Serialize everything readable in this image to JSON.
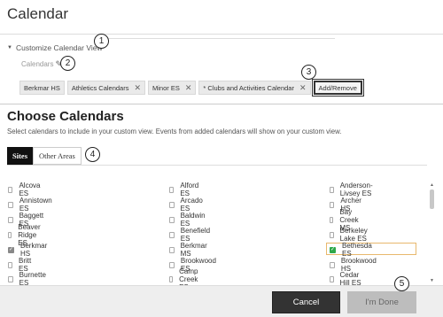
{
  "window": {
    "title": "Calendar"
  },
  "customize": {
    "toggle_label": "Customize Calendar View",
    "calendars_label": "Calendars",
    "chips": [
      {
        "label": "Berkmar HS",
        "removable": false
      },
      {
        "label": "Athletics Calendars",
        "removable": true
      },
      {
        "label": "Minor ES",
        "removable": true
      },
      {
        "label": "* Clubs and Activities Calendar",
        "removable": true
      }
    ],
    "add_remove_label": "Add/Remove"
  },
  "choose": {
    "title": "Choose Calendars",
    "description": "Select calendars to include in your custom view. Events from added calendars will show on your custom view.",
    "tabs": [
      {
        "label": "Sites",
        "active": true
      },
      {
        "label": "Other Areas",
        "active": false
      }
    ],
    "columns": [
      [
        {
          "label": "Alcova ES",
          "checked": false
        },
        {
          "label": "Annistown ES",
          "checked": false
        },
        {
          "label": "Baggett ES",
          "checked": false
        },
        {
          "label": "Beaver Ridge ES",
          "checked": false
        },
        {
          "label": "Berkmar HS",
          "checked": true,
          "locked": true
        },
        {
          "label": "Britt ES",
          "checked": false
        },
        {
          "label": "Burnette ES",
          "checked": false
        }
      ],
      [
        {
          "label": "Alford ES",
          "checked": false
        },
        {
          "label": "Arcado ES",
          "checked": false
        },
        {
          "label": "Baldwin ES",
          "checked": false
        },
        {
          "label": "Benefield ES",
          "checked": false
        },
        {
          "label": "Berkmar MS",
          "checked": false
        },
        {
          "label": "Brookwood ES",
          "checked": false
        },
        {
          "label": "Camp Creek ES",
          "checked": false
        }
      ],
      [
        {
          "label": "Anderson-Livsey ES",
          "checked": false
        },
        {
          "label": "Archer HS",
          "checked": false
        },
        {
          "label": "Bay Creek MS",
          "checked": false
        },
        {
          "label": "Berkeley Lake ES",
          "checked": false
        },
        {
          "label": "Bethesda ES",
          "checked": true,
          "locked": false
        },
        {
          "label": "Brookwood HS",
          "checked": false
        },
        {
          "label": "Cedar Hill ES",
          "checked": false
        }
      ]
    ]
  },
  "footer": {
    "cancel_label": "Cancel",
    "done_label": "I'm Done"
  },
  "callouts": [
    "1",
    "2",
    "3",
    "4",
    "5"
  ],
  "icons": {
    "pencil": "pencil-icon",
    "remove": "close-icon",
    "collapse": "triangle-down-icon",
    "check": "checkmark-icon"
  },
  "colors": {
    "active_tab": "#111111",
    "checked_green": "#2ea84a",
    "locked_gray": "#888888",
    "cancel_button": "#333333",
    "done_button_disabled": "#bdbdbd",
    "highlight_border": "#e8b86d"
  }
}
